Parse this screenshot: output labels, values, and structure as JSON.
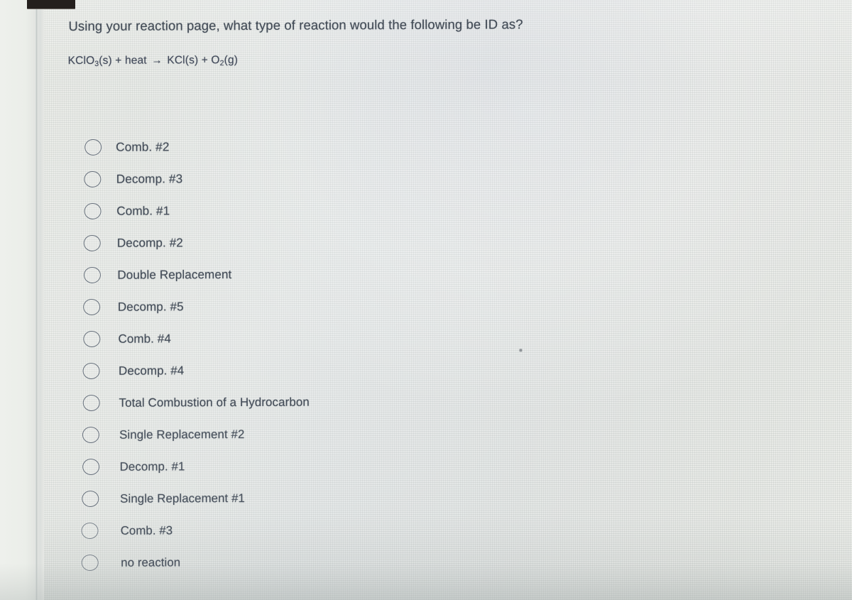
{
  "question": {
    "prompt": "Using your reaction page, what type of reaction would the following be ID as?",
    "equation": {
      "reactant_1": "KClO",
      "reactant_1_sub": "3",
      "reactant_1_state": "(s)",
      "plus_1": "+",
      "reactant_2": "heat",
      "arrow": "→",
      "product_1": "KCl(s)",
      "plus_2": "+",
      "product_2": "O",
      "product_2_sub": "2",
      "product_2_state": "(g)",
      "full_text": "KClO3(s) + heat → KCl(s) + O2(g)"
    }
  },
  "options": [
    {
      "label": "Comb. #2",
      "selected": false
    },
    {
      "label": "Decomp. #3",
      "selected": false
    },
    {
      "label": "Comb. #1",
      "selected": false
    },
    {
      "label": "Decomp. #2",
      "selected": false
    },
    {
      "label": "Double Replacement",
      "selected": false
    },
    {
      "label": "Decomp. #5",
      "selected": false
    },
    {
      "label": "Comb. #4",
      "selected": false
    },
    {
      "label": "Decomp. #4",
      "selected": false
    },
    {
      "label": "Total Combustion of a Hydrocarbon",
      "selected": false
    },
    {
      "label": "Single Replacement #2",
      "selected": false
    },
    {
      "label": "Decomp. #1",
      "selected": false
    },
    {
      "label": "Single Replacement #1",
      "selected": false
    },
    {
      "label": "Comb. #3",
      "selected": false
    },
    {
      "label": "no reaction",
      "selected": false
    }
  ],
  "artifacts": {
    "redaction_bar": "redacted-black-bar",
    "dust_speck": "screen-dust-speck"
  },
  "colors": {
    "text": "#424b57",
    "radio_border": "#5b6572",
    "background": "#e4e7e4",
    "redaction": "#241f1d"
  }
}
